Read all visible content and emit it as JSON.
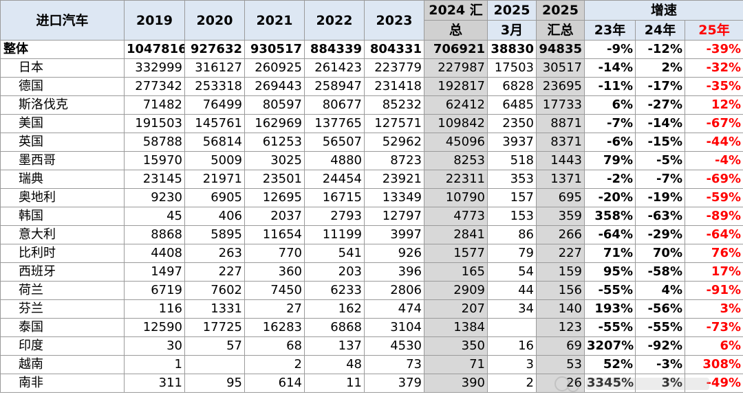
{
  "header": {
    "title": "进口汽车",
    "y2019": "2019",
    "y2020": "2020",
    "y2021": "2021",
    "y2022": "2022",
    "y2023": "2023",
    "total2024_top": "2024 汇",
    "total2024_bottom": "总",
    "mar2025_top": "2025",
    "mar2025_bottom": "3月",
    "total2025_top": "2025",
    "total2025_bottom": "汇总",
    "growth": "增速",
    "g23": "23年",
    "g24": "24年",
    "g25": "25年"
  },
  "rows": [
    {
      "name": "整体",
      "v2019": "1047816",
      "v2020": "927632",
      "v2021": "930517",
      "v2022": "884339",
      "v2023": "804331",
      "t2024": "706921",
      "mar2025": "38830",
      "t2025": "94835",
      "g23": "-9%",
      "g24": "-12%",
      "g25": "-39%"
    },
    {
      "name": "日本",
      "v2019": "332999",
      "v2020": "316127",
      "v2021": "260925",
      "v2022": "261423",
      "v2023": "223779",
      "t2024": "227987",
      "mar2025": "17503",
      "t2025": "30517",
      "g23": "-14%",
      "g24": "2%",
      "g25": "-32%"
    },
    {
      "name": "德国",
      "v2019": "277342",
      "v2020": "253318",
      "v2021": "269443",
      "v2022": "258947",
      "v2023": "231418",
      "t2024": "192817",
      "mar2025": "6828",
      "t2025": "23695",
      "g23": "-11%",
      "g24": "-17%",
      "g25": "-35%"
    },
    {
      "name": "斯洛伐克",
      "v2019": "71482",
      "v2020": "76499",
      "v2021": "80597",
      "v2022": "80677",
      "v2023": "85232",
      "t2024": "62412",
      "mar2025": "6485",
      "t2025": "17733",
      "g23": "6%",
      "g24": "-27%",
      "g25": "12%"
    },
    {
      "name": "美国",
      "v2019": "191503",
      "v2020": "145761",
      "v2021": "162969",
      "v2022": "137765",
      "v2023": "127571",
      "t2024": "109842",
      "mar2025": "2350",
      "t2025": "8871",
      "g23": "-7%",
      "g24": "-14%",
      "g25": "-67%"
    },
    {
      "name": "英国",
      "v2019": "58788",
      "v2020": "56814",
      "v2021": "61253",
      "v2022": "56507",
      "v2023": "52962",
      "t2024": "45096",
      "mar2025": "3937",
      "t2025": "8371",
      "g23": "-6%",
      "g24": "-15%",
      "g25": "-44%"
    },
    {
      "name": "墨西哥",
      "v2019": "15970",
      "v2020": "5009",
      "v2021": "3025",
      "v2022": "4880",
      "v2023": "8723",
      "t2024": "8253",
      "mar2025": "518",
      "t2025": "1443",
      "g23": "79%",
      "g24": "-5%",
      "g25": "-4%"
    },
    {
      "name": "瑞典",
      "v2019": "23145",
      "v2020": "21971",
      "v2021": "23501",
      "v2022": "24454",
      "v2023": "23921",
      "t2024": "22311",
      "mar2025": "353",
      "t2025": "1371",
      "g23": "-2%",
      "g24": "-7%",
      "g25": "-69%"
    },
    {
      "name": "奥地利",
      "v2019": "9230",
      "v2020": "6905",
      "v2021": "12695",
      "v2022": "16715",
      "v2023": "13349",
      "t2024": "10790",
      "mar2025": "157",
      "t2025": "695",
      "g23": "-20%",
      "g24": "-19%",
      "g25": "-59%"
    },
    {
      "name": "韩国",
      "v2019": "45",
      "v2020": "406",
      "v2021": "2037",
      "v2022": "2793",
      "v2023": "12797",
      "t2024": "4773",
      "mar2025": "153",
      "t2025": "359",
      "g23": "358%",
      "g24": "-63%",
      "g25": "-89%"
    },
    {
      "name": "意大利",
      "v2019": "8868",
      "v2020": "5895",
      "v2021": "11654",
      "v2022": "11199",
      "v2023": "3997",
      "t2024": "2841",
      "mar2025": "86",
      "t2025": "266",
      "g23": "-64%",
      "g24": "-29%",
      "g25": "-64%"
    },
    {
      "name": "比利时",
      "v2019": "4408",
      "v2020": "263",
      "v2021": "770",
      "v2022": "541",
      "v2023": "926",
      "t2024": "1577",
      "mar2025": "79",
      "t2025": "227",
      "g23": "71%",
      "g24": "70%",
      "g25": "76%"
    },
    {
      "name": "西班牙",
      "v2019": "1497",
      "v2020": "227",
      "v2021": "360",
      "v2022": "203",
      "v2023": "396",
      "t2024": "165",
      "mar2025": "54",
      "t2025": "159",
      "g23": "95%",
      "g24": "-58%",
      "g25": "17%"
    },
    {
      "name": "荷兰",
      "v2019": "6719",
      "v2020": "7602",
      "v2021": "7450",
      "v2022": "6233",
      "v2023": "2806",
      "t2024": "2909",
      "mar2025": "44",
      "t2025": "156",
      "g23": "-55%",
      "g24": "4%",
      "g25": "-91%"
    },
    {
      "name": "芬兰",
      "v2019": "116",
      "v2020": "1331",
      "v2021": "27",
      "v2022": "162",
      "v2023": "474",
      "t2024": "207",
      "mar2025": "34",
      "t2025": "140",
      "g23": "193%",
      "g24": "-56%",
      "g25": "3%"
    },
    {
      "name": "泰国",
      "v2019": "12590",
      "v2020": "17725",
      "v2021": "16283",
      "v2022": "6868",
      "v2023": "3104",
      "t2024": "1384",
      "mar2025": "",
      "t2025": "123",
      "g23": "-55%",
      "g24": "-55%",
      "g25": "-73%"
    },
    {
      "name": "印度",
      "v2019": "30",
      "v2020": "57",
      "v2021": "68",
      "v2022": "137",
      "v2023": "4530",
      "t2024": "350",
      "mar2025": "16",
      "t2025": "69",
      "g23": "3207%",
      "g24": "-92%",
      "g25": "6%"
    },
    {
      "name": "越南",
      "v2019": "1",
      "v2020": "",
      "v2021": "2",
      "v2022": "48",
      "v2023": "73",
      "t2024": "71",
      "mar2025": "3",
      "t2025": "53",
      "g23": "52%",
      "g24": "-3%",
      "g25": "308%"
    },
    {
      "name": "南非",
      "v2019": "311",
      "v2020": "95",
      "v2021": "614",
      "v2022": "11",
      "v2023": "379",
      "t2024": "390",
      "mar2025": "2",
      "t2025": "26",
      "g23": "3345%",
      "g24": "3%",
      "g25": "-49%"
    }
  ],
  "colors": {
    "header_bg": "#dde7f3",
    "grey_col": "#d8d8d8",
    "accent_red": "#ff0000"
  }
}
